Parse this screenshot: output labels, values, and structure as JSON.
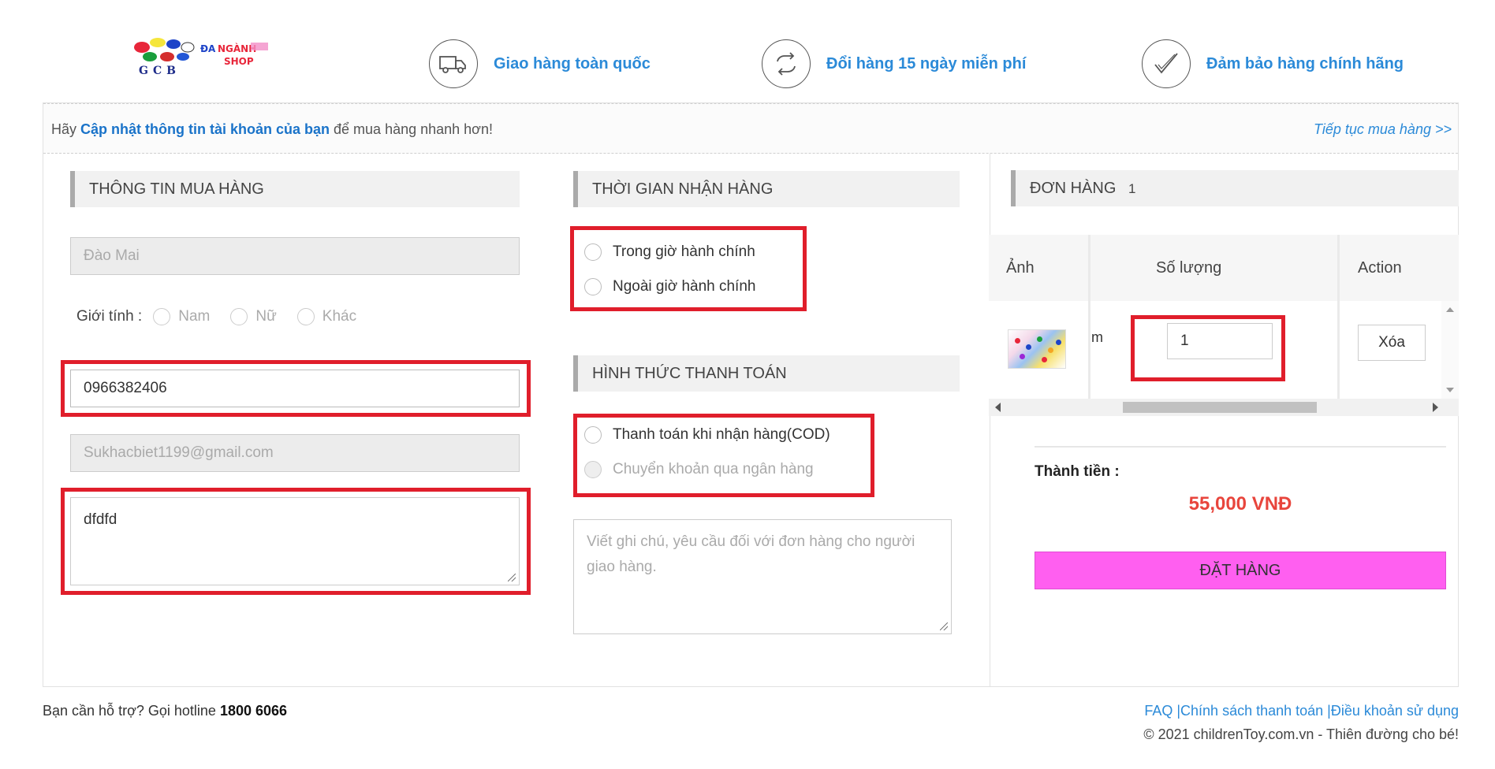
{
  "header": {
    "logo_text": "GCB ĐA NGÀNH SHOP",
    "features": [
      {
        "icon": "truck-icon",
        "label": "Giao hàng toàn quốc"
      },
      {
        "icon": "exchange-icon",
        "label": "Đổi hàng 15 ngày miễn phí"
      },
      {
        "icon": "checkmark-icon",
        "label": "Đảm bảo hàng chính hãng"
      }
    ]
  },
  "notice": {
    "prefix": "Hãy ",
    "link": "Cập nhật thông tin tài khoản của bạn",
    "suffix": " để mua hàng nhanh hơn!",
    "continue": "Tiếp tục mua hàng >>"
  },
  "buyer": {
    "title": "THÔNG TIN MUA HÀNG",
    "name": "Đào Mai",
    "gender_label": "Giới tính :",
    "genders": [
      "Nam",
      "Nữ",
      "Khác"
    ],
    "phone": "0966382406",
    "email": "Sukhacbiet1199@gmail.com",
    "address": "dfdfd"
  },
  "delivery": {
    "title": "THỜI GIAN NHẬN HÀNG",
    "options": [
      "Trong giờ hành chính",
      "Ngoài giờ hành chính"
    ]
  },
  "payment": {
    "title": "HÌNH THỨC THANH TOÁN",
    "options": [
      "Thanh toán khi nhận hàng(COD)",
      "Chuyển khoản qua ngân hàng"
    ],
    "note_placeholder": "Viết ghi chú, yêu cầu đối với đơn hàng cho người giao hàng."
  },
  "order": {
    "title": "ĐƠN HÀNG",
    "count": "1",
    "columns": [
      "Ảnh",
      "Số lượng",
      "Action"
    ],
    "cut_text": "m",
    "quantity": "1",
    "delete_label": "Xóa",
    "total_label": "Thành tiền :",
    "total_value": "55,000 VNĐ",
    "submit_label": "ĐẶT HÀNG"
  },
  "footer": {
    "support_prefix": "Bạn cần hỗ trợ? Gọi hotline ",
    "hotline": "1800 6066",
    "links": "FAQ |Chính sách thanh toán |Điều khoản sử dụng",
    "copyright": "© 2021 childrenToy.com.vn - Thiên đường cho bé!"
  },
  "colors": {
    "accent_blue": "#2b8ad8",
    "highlight_red": "#e01e2b",
    "order_button": "#ff5ff0",
    "total_red": "#e8453c"
  }
}
